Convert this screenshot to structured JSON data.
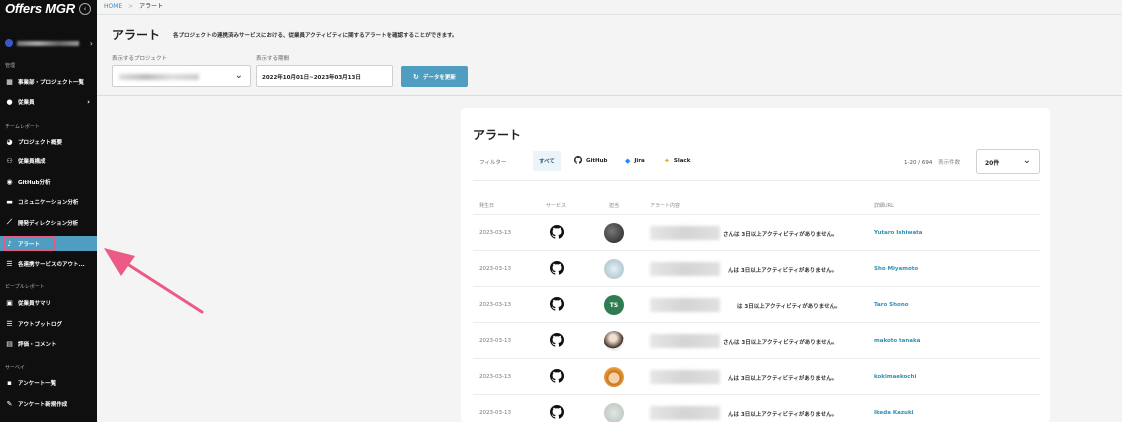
{
  "sidebar": {
    "brand": "Offers MGR",
    "collapse_icon": "‹",
    "sections": {
      "management": "管理",
      "team_report": "チームレポート",
      "people_report": "ピープルレポート",
      "survey": "サーベイ"
    },
    "items": [
      {
        "label": "事業部・プロジェクト一覧",
        "icon": "building-icon"
      },
      {
        "label": "従業員",
        "icon": "person-icon"
      },
      {
        "label": "プロジェクト概要",
        "icon": "pie-chart-icon"
      },
      {
        "label": "従業員構成",
        "icon": "people-icon"
      },
      {
        "label": "GitHub分析",
        "icon": "github-icon"
      },
      {
        "label": "コミュニケーション分析",
        "icon": "chat-icon"
      },
      {
        "label": "開発ディレクション分析",
        "icon": "line-chart-icon"
      },
      {
        "label": "アラート",
        "icon": "bell-icon"
      },
      {
        "label": "各連携サービスのアウト...",
        "icon": "list-icon"
      },
      {
        "label": "従業員サマリ",
        "icon": "id-card-icon"
      },
      {
        "label": "アウトプットログ",
        "icon": "list-icon"
      },
      {
        "label": "評価・コメント",
        "icon": "document-icon"
      },
      {
        "label": "アンケート一覧",
        "icon": "survey-icon"
      },
      {
        "label": "アンケート新規作成",
        "icon": "edit-icon"
      }
    ]
  },
  "breadcrumb": {
    "home": "HOME",
    "separator": ">",
    "current": "アラート"
  },
  "header": {
    "title": "アラート",
    "description": "各プロジェクトの連携済みサービスにおける、従業員アクティビティに関するアラートを確認することができます。"
  },
  "filters": {
    "project_label": "表示するプロジェクト",
    "period_label": "表示する期間",
    "period_value": "2022年10月01日~2023年03月13日",
    "refresh_label": "データを更新"
  },
  "card": {
    "title": "アラート",
    "filter_label": "フィルター",
    "tabs": [
      {
        "label": "すべて",
        "icon": ""
      },
      {
        "label": "GitHub",
        "icon": "github-icon"
      },
      {
        "label": "Jira",
        "icon": "jira-icon"
      },
      {
        "label": "Slack",
        "icon": "slack-icon"
      }
    ],
    "pagination": "1-20 / 694",
    "per_page_label": "表示件数",
    "per_page_value": "20件"
  },
  "table": {
    "columns": [
      "発生日",
      "サービス",
      "担当",
      "アラート内容",
      "詳細URL"
    ],
    "rows": [
      {
        "date": "2023-03-13",
        "message": "さんは 3日以上アクティビティがありません。",
        "link": "Yutaro Ishiwata",
        "avatar_initials": ""
      },
      {
        "date": "2023-03-13",
        "message": "んは 3日以上アクティビティがありません。",
        "link": "Sho Miyamoto",
        "avatar_initials": ""
      },
      {
        "date": "2023-03-13",
        "message": "は 3日以上アクティビティがありません。",
        "link": "Taro Shono",
        "avatar_initials": "TS"
      },
      {
        "date": "2023-03-13",
        "message": "さんは 3日以上アクティビティがありません。",
        "link": "makoto tanaka",
        "avatar_initials": ""
      },
      {
        "date": "2023-03-13",
        "message": "んは 3日以上アクティビティがありません。",
        "link": "kokimaekochi",
        "avatar_initials": ""
      },
      {
        "date": "2023-03-13",
        "message": "んは 3日以上アクティビティがありません。",
        "link": "Ikeda Kazuki",
        "avatar_initials": ""
      }
    ]
  },
  "colors": {
    "accent": "#4f9dc1",
    "highlight": "#e85a7d",
    "sidebar_bg": "#0f0f0f",
    "link": "#2e8fb9"
  }
}
